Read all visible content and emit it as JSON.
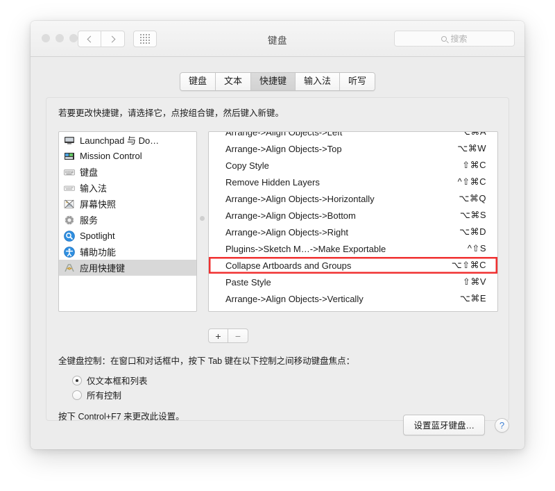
{
  "window": {
    "title": "键盘",
    "search_placeholder": "搜索"
  },
  "tabs": [
    {
      "label": "键盘",
      "active": false
    },
    {
      "label": "文本",
      "active": false
    },
    {
      "label": "快捷键",
      "active": true
    },
    {
      "label": "输入法",
      "active": false
    },
    {
      "label": "听写",
      "active": false
    }
  ],
  "hint": "若要更改快捷键，请选择它，点按组合键，然后键入新键。",
  "sidebar": {
    "items": [
      {
        "label": "Launchpad 与 Do…",
        "icon": "display-icon",
        "selected": false
      },
      {
        "label": "Mission Control",
        "icon": "mission-control-icon",
        "selected": false
      },
      {
        "label": "键盘",
        "icon": "keyboard-icon",
        "selected": false
      },
      {
        "label": "输入法",
        "icon": "input-sources-icon",
        "selected": false
      },
      {
        "label": "屏幕快照",
        "icon": "screenshot-icon",
        "selected": false
      },
      {
        "label": "服务",
        "icon": "gear-icon",
        "selected": false
      },
      {
        "label": "Spotlight",
        "icon": "spotlight-icon",
        "selected": false
      },
      {
        "label": "辅助功能",
        "icon": "accessibility-icon",
        "selected": false
      },
      {
        "label": "应用快捷键",
        "icon": "app-shortcuts-icon",
        "selected": true
      }
    ]
  },
  "shortcuts": {
    "rows": [
      {
        "name": "Arrange->Align Objects->Left",
        "keys": "⌥⌘A",
        "highlighted": false
      },
      {
        "name": "Arrange->Align Objects->Top",
        "keys": "⌥⌘W",
        "highlighted": false
      },
      {
        "name": "Copy Style",
        "keys": "⇧⌘C",
        "highlighted": false
      },
      {
        "name": "Remove Hidden Layers",
        "keys": "^⇧⌘C",
        "highlighted": false
      },
      {
        "name": "Arrange->Align Objects->Horizontally",
        "keys": "⌥⌘Q",
        "highlighted": false
      },
      {
        "name": "Arrange->Align Objects->Bottom",
        "keys": "⌥⌘S",
        "highlighted": false
      },
      {
        "name": "Arrange->Align Objects->Right",
        "keys": "⌥⌘D",
        "highlighted": false
      },
      {
        "name": "Plugins->Sketch M…->Make Exportable",
        "keys": "^⇧S",
        "highlighted": false
      },
      {
        "name": "Collapse Artboards and Groups",
        "keys": "⌥⇧⌘C",
        "highlighted": true
      },
      {
        "name": "Paste Style",
        "keys": "⇧⌘V",
        "highlighted": false
      },
      {
        "name": "Arrange->Align Objects->Vertically",
        "keys": "⌥⌘E",
        "highlighted": false
      }
    ],
    "highlight_color": "#f03030"
  },
  "list_buttons": {
    "add_label": "+",
    "remove_label": "−"
  },
  "full_keyboard_access": {
    "description": "全键盘控制：在窗口和对话框中，按下 Tab 键在以下控制之间移动键盘焦点：",
    "options": [
      {
        "label": "仅文本框和列表",
        "selected": true
      },
      {
        "label": "所有控制",
        "selected": false
      }
    ],
    "note": "按下 Control+F7 来更改此设置。"
  },
  "footer": {
    "bluetooth_button": "设置蓝牙键盘…",
    "help_button": "?"
  }
}
